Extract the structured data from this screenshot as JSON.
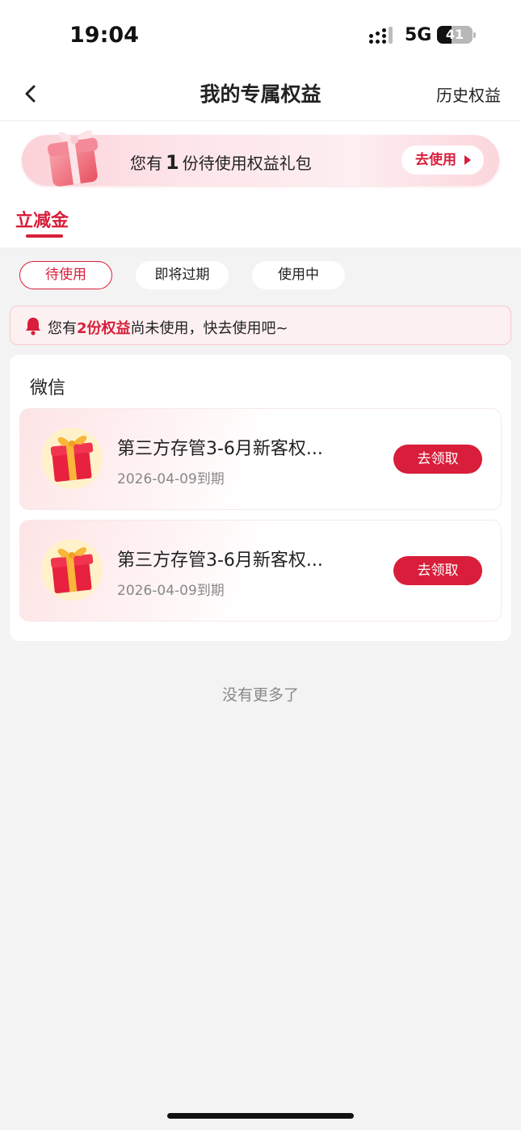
{
  "status_bar": {
    "time": "19:04",
    "network": "5G",
    "battery": "41"
  },
  "nav": {
    "title": "我的专属权益",
    "history_label": "历史权益"
  },
  "banner": {
    "prefix": "您有",
    "count": "1",
    "suffix": "份待使用权益礼包",
    "button_label": "去使用"
  },
  "category_tab": {
    "label": "立减金"
  },
  "filters": [
    {
      "label": "待使用",
      "active": true
    },
    {
      "label": "即将过期",
      "active": false
    },
    {
      "label": "使用中",
      "active": false
    }
  ],
  "notice": {
    "prefix": "您有",
    "highlight": "2份权益",
    "suffix": "尚未使用，快去使用吧~"
  },
  "card": {
    "title": "微信",
    "items": [
      {
        "title": "第三方存管3-6月新客权...",
        "date": "2026-04-09到期",
        "button_label": "去领取"
      },
      {
        "title": "第三方存管3-6月新客权...",
        "date": "2026-04-09到期",
        "button_label": "去领取"
      }
    ]
  },
  "footer": {
    "no_more": "没有更多了"
  },
  "colors": {
    "accent": "#d81e3a",
    "background": "#f3f3f3"
  }
}
